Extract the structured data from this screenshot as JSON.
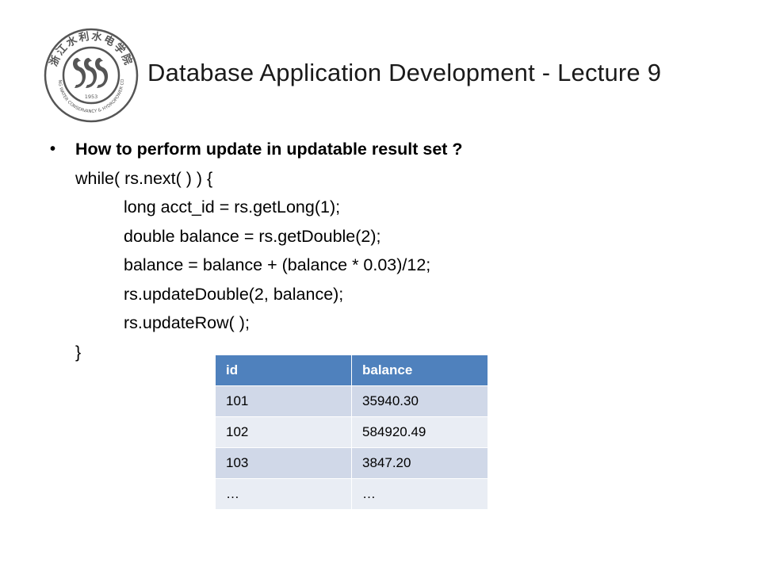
{
  "header": {
    "title": "Database Application Development - Lecture 9"
  },
  "logo": {
    "top_text": "浙江水利水电学院",
    "bottom_text": "ZHEJIANG WATER CONSERVANCY & HYDROPOWER COLLEGE",
    "year": "1953"
  },
  "slide": {
    "bullet_marker": "•",
    "heading": "How to perform update in updatable result set ?",
    "code_lines": [
      "while( rs.next( ) ) {",
      "long acct_id = rs.getLong(1);",
      "double balance = rs.getDouble(2);",
      "balance = balance + (balance * 0.03)/12;",
      "rs.updateDouble(2, balance);",
      "rs.updateRow( );",
      "}"
    ]
  },
  "table": {
    "headers": [
      "id",
      "balance"
    ],
    "rows": [
      [
        "101",
        "35940.30"
      ],
      [
        "102",
        "584920.49"
      ],
      [
        "103",
        "3847.20"
      ],
      [
        "…",
        "…"
      ]
    ]
  },
  "colors": {
    "header_fill": "#4f81bd",
    "row_odd": "#d0d8e8",
    "row_even": "#e9edf4",
    "logo_ink": "#555555"
  }
}
